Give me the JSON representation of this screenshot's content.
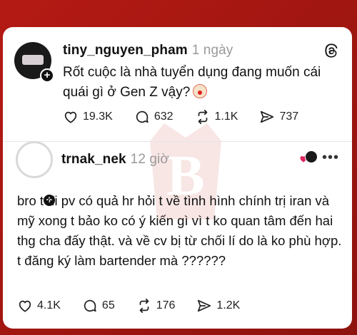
{
  "posts": [
    {
      "username": "tiny_nguyen_pham",
      "time": "1 ngày",
      "text": "Rốt cuộc là nhà tuyển dụng đang muốn cái quái gì ở Gen Z vậy?",
      "actions": {
        "likes": "19.3K",
        "replies": "632",
        "reposts": "1.1K",
        "shares": "737"
      }
    },
    {
      "username": "trnak_nek",
      "time": "12 giờ",
      "text": "bro t đi pv có quả hr hỏi t về tình hình chính trị iran và mỹ xong t bảo ko có ý kiến gì vì t ko quan tâm đến hai thg cha đấy thật. và về cv bị từ chối lí do là ko phù hợp. t đăng ký làm bartender mà ??????",
      "actions": {
        "likes": "4.1K",
        "replies": "65",
        "reposts": "176",
        "shares": "1.2K"
      }
    }
  ],
  "icons": {
    "like": "heart-icon",
    "reply": "comment-icon",
    "repost": "repost-icon",
    "share": "share-icon",
    "follow": "plus-icon",
    "app": "threads-logo-icon",
    "menu": "more-icon"
  },
  "colors": {
    "background": "#9c1410",
    "card": "#ffffff",
    "text": "#111111",
    "muted": "#9a9a9a"
  }
}
